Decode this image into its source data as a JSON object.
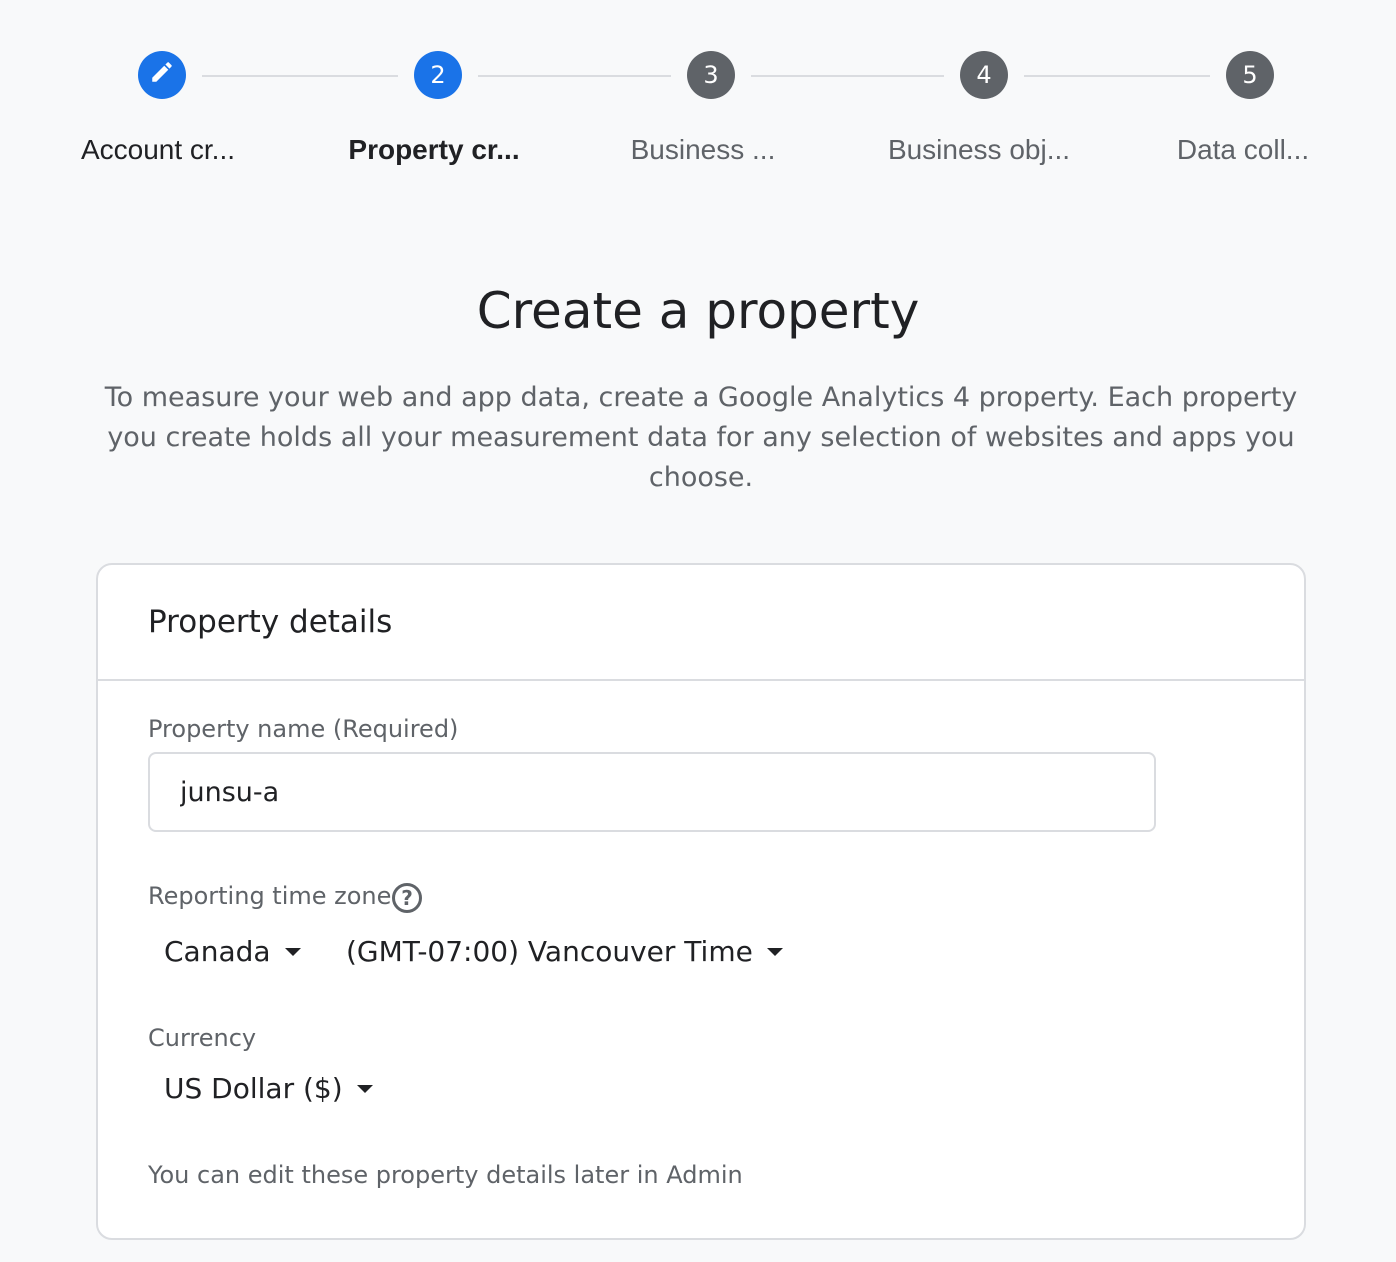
{
  "stepper": {
    "steps": [
      {
        "number": "",
        "icon": "pencil-icon",
        "label": "Account cr...",
        "state": "done"
      },
      {
        "number": "2",
        "label": "Property cr...",
        "state": "active"
      },
      {
        "number": "3",
        "label": "Business ...",
        "state": "todo"
      },
      {
        "number": "4",
        "label": "Business obj...",
        "state": "todo"
      },
      {
        "number": "5",
        "label": "Data coll...",
        "state": "todo"
      }
    ]
  },
  "page": {
    "title": "Create a property",
    "description": "To measure your web and app data, create a Google Analytics 4 property. Each property you create holds all your measurement data for any selection of websites and apps you choose."
  },
  "card": {
    "title": "Property details",
    "property_name": {
      "label": "Property name (Required)",
      "value": "junsu-a"
    },
    "time_zone": {
      "label": "Reporting time zone",
      "help_icon": "help-circle-icon",
      "country": "Canada",
      "zone": "(GMT-07:00) Vancouver Time"
    },
    "currency": {
      "label": "Currency",
      "value": "US Dollar ($)"
    },
    "footnote": "You can edit these property details later in Admin"
  },
  "colors": {
    "accent": "#1a73e8",
    "inactive_step": "#5f6368",
    "background": "#f8f9fa",
    "border": "#dadce0"
  }
}
